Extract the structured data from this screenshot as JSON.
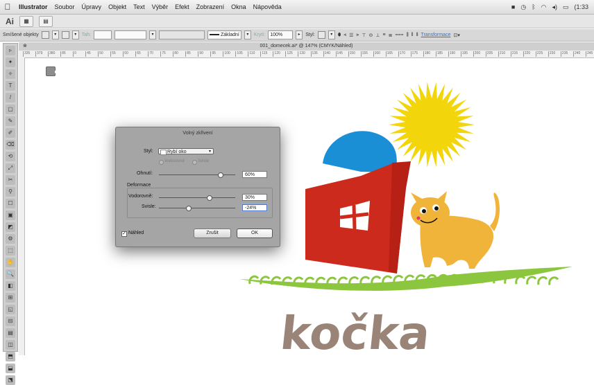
{
  "menubar": {
    "app_name": "Illustrator",
    "items": [
      "Soubor",
      "Úpravy",
      "Objekt",
      "Text",
      "Výběr",
      "Efekt",
      "Zobrazení",
      "Okna",
      "Nápověda"
    ],
    "clock": "(1:33"
  },
  "appbar": {
    "logo": "Ai"
  },
  "control_bar": {
    "selection_label": "Smíšené objekty",
    "stroke_label": "Tah:",
    "stroke_style": "Základní",
    "opacity_label": "Krytí:",
    "opacity_value": "100%",
    "style_label": "Styl:",
    "transform_link": "Transformace"
  },
  "document_tab": {
    "title": "001_domecek.ai* @ 147% (CMYK/Náhled)"
  },
  "ruler": {
    "ticks": [
      "335",
      "379",
      "380",
      "85",
      "0",
      "45",
      "50",
      "55",
      "60",
      "65",
      "70",
      "75",
      "80",
      "85",
      "90",
      "95",
      "100",
      "105",
      "110",
      "115",
      "120",
      "125",
      "130",
      "135",
      "140",
      "145",
      "150",
      "155",
      "160",
      "165",
      "170",
      "175",
      "180",
      "185",
      "190",
      "195",
      "200",
      "205",
      "210",
      "215",
      "220",
      "225",
      "230",
      "235",
      "240",
      "245"
    ]
  },
  "tools": [
    "▸",
    "▹",
    "✦",
    "✧",
    "T",
    "/",
    "▢",
    "✎",
    "✐",
    "⌫",
    "⟲",
    "⤢",
    "✂",
    "⚲",
    "☐",
    "▣",
    "◩",
    "⚙",
    "⬚",
    "✋",
    "🔍",
    "◧",
    "⊞",
    "◱",
    "⊟",
    "▤",
    "◫",
    "⬒",
    "⬓",
    "⬔"
  ],
  "dialog": {
    "title": "Volný zkřivení",
    "style_label": "Styl:",
    "style_value": "Rybí oko",
    "horizontal": "Vodorovně",
    "vertical": "Svisle",
    "bend_label": "Ohnutí:",
    "bend_value": "60%",
    "bend_level": 0.8,
    "distortion_label": "Deformace",
    "horiz_label": "Vodorovně:",
    "horiz_value": "30%",
    "horiz_level": 0.65,
    "vert_label": "Svisle:",
    "vert_value": "-24%",
    "vert_level": 0.38,
    "preview_label": "Náhled",
    "preview_checked": "✓",
    "cancel_label": "Zrušit",
    "ok_label": "OK"
  },
  "artwork": {
    "word": "kočka",
    "colors": {
      "sun": "#f2d60b",
      "dome": "#1a8fd6",
      "house": "#cc2a1d",
      "cat": "#f0b43a",
      "grass": "#8cc63f",
      "text": "#9a8478"
    }
  }
}
